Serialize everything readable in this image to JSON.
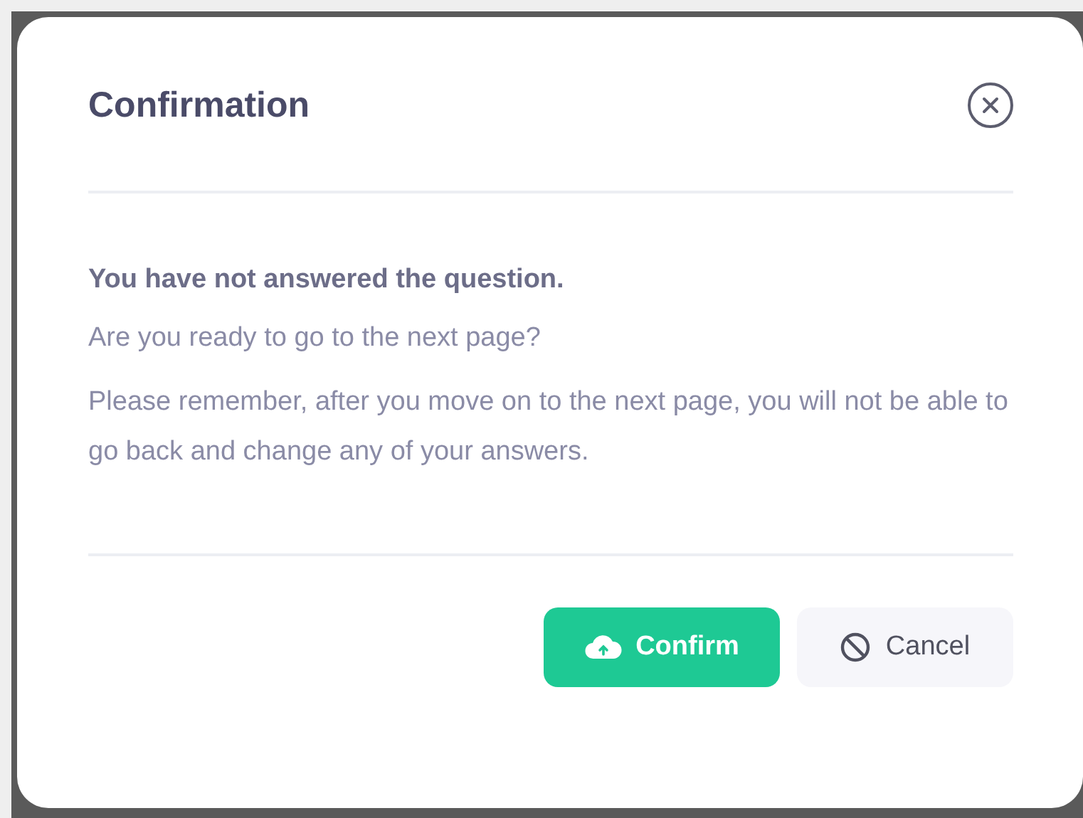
{
  "dialog": {
    "title": "Confirmation",
    "message": {
      "heading": "You have not answered the question.",
      "question": "Are you ready to go to the next page?",
      "note": "Please remember, after you move on to the next page, you will not be able to go back and change any of your answers."
    },
    "buttons": [
      {
        "kind": "confirm",
        "label": "Confirm"
      },
      {
        "kind": "cancel",
        "label": "Cancel"
      }
    ]
  }
}
